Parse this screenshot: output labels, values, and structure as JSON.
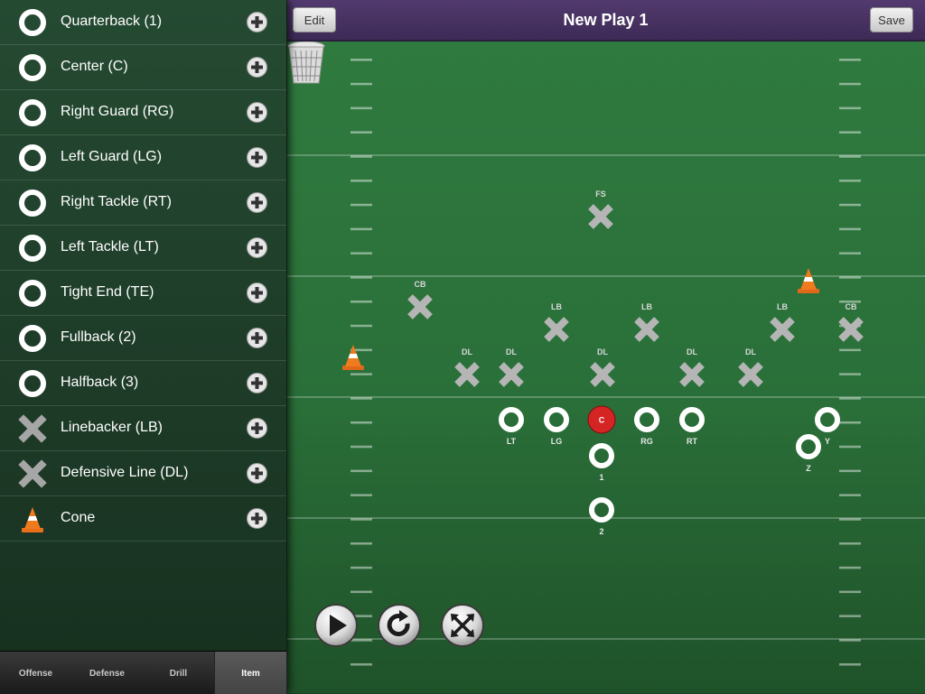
{
  "sidebar": {
    "items": [
      {
        "label": "Quarterback (1)",
        "icon": "ring-icon"
      },
      {
        "label": "Center (C)",
        "icon": "ring-icon"
      },
      {
        "label": "Right Guard (RG)",
        "icon": "ring-icon"
      },
      {
        "label": "Left Guard (LG)",
        "icon": "ring-icon"
      },
      {
        "label": "Right Tackle (RT)",
        "icon": "ring-icon"
      },
      {
        "label": "Left Tackle (LT)",
        "icon": "ring-icon"
      },
      {
        "label": "Tight End (TE)",
        "icon": "ring-icon"
      },
      {
        "label": "Fullback (2)",
        "icon": "ring-icon"
      },
      {
        "label": "Halfback (3)",
        "icon": "ring-icon"
      },
      {
        "label": "Linebacker (LB)",
        "icon": "x-icon"
      },
      {
        "label": "Defensive Line (DL)",
        "icon": "x-icon"
      },
      {
        "label": "Cone",
        "icon": "cone-icon"
      }
    ]
  },
  "tabs": [
    {
      "label": "Offense",
      "active": false
    },
    {
      "label": "Defense",
      "active": false
    },
    {
      "label": "Drill",
      "active": false
    },
    {
      "label": "Item",
      "active": true
    }
  ],
  "header": {
    "title": "New Play 1",
    "edit_label": "Edit",
    "save_label": "Save"
  },
  "field": {
    "defense": [
      {
        "label": "FS"
      },
      {
        "label": "CB"
      },
      {
        "label": "LB"
      },
      {
        "label": "LB"
      },
      {
        "label": "LB"
      },
      {
        "label": "CB"
      },
      {
        "label": "DL"
      },
      {
        "label": "DL"
      },
      {
        "label": "DL"
      },
      {
        "label": "DL"
      },
      {
        "label": "DL"
      }
    ],
    "offense": [
      {
        "label": "LT"
      },
      {
        "label": "LG"
      },
      {
        "label": "C"
      },
      {
        "label": "RG"
      },
      {
        "label": "RT"
      },
      {
        "label": "1"
      },
      {
        "label": "2"
      },
      {
        "label": "Y"
      },
      {
        "label": "Z"
      }
    ],
    "cones": 2
  },
  "controls": {
    "play": "play-icon",
    "reset": "refresh-icon",
    "clear": "shuffle-icon",
    "trash": "trash-icon"
  },
  "colors": {
    "field": "#2f7a3f",
    "center_player": "#d42424",
    "header": "#4a3465",
    "sidebar": "#214330",
    "cone": "#f07a1e"
  }
}
